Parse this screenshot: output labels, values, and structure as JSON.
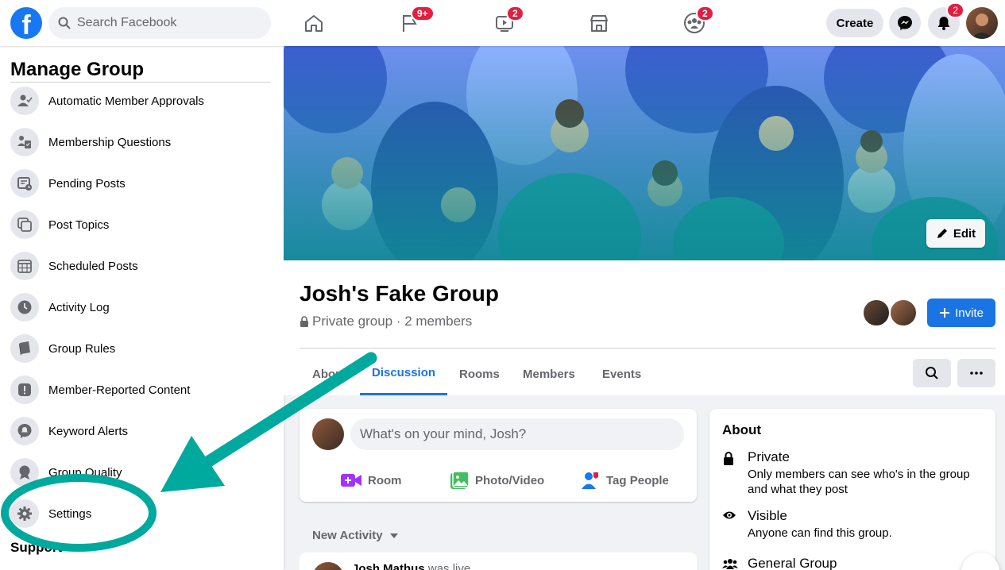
{
  "topbar": {
    "logo": "f",
    "search_placeholder": "Search Facebook",
    "nav": [
      {
        "name": "home-icon",
        "badge": ""
      },
      {
        "name": "pages-flag-icon",
        "badge": "9+"
      },
      {
        "name": "watch-icon",
        "badge": "2"
      },
      {
        "name": "marketplace-icon",
        "badge": ""
      },
      {
        "name": "groups-icon",
        "badge": "2"
      }
    ],
    "create_label": "Create",
    "notifications_badge": "2"
  },
  "sidebar": {
    "title": "Manage Group",
    "items": [
      {
        "label": "Automatic Member Approvals",
        "icon": "member-approval-icon"
      },
      {
        "label": "Membership Questions",
        "icon": "membership-questions-icon"
      },
      {
        "label": "Pending Posts",
        "icon": "pending-posts-icon"
      },
      {
        "label": "Post Topics",
        "icon": "post-topics-icon"
      },
      {
        "label": "Scheduled Posts",
        "icon": "calendar-icon"
      },
      {
        "label": "Activity Log",
        "icon": "clock-icon"
      },
      {
        "label": "Group Rules",
        "icon": "book-icon"
      },
      {
        "label": "Member-Reported Content",
        "icon": "alert-icon"
      },
      {
        "label": "Keyword Alerts",
        "icon": "keyword-alert-icon"
      },
      {
        "label": "Group Quality",
        "icon": "badge-icon"
      },
      {
        "label": "Settings",
        "icon": "gear-icon"
      }
    ],
    "support_heading": "Support"
  },
  "cover": {
    "edit_label": "Edit"
  },
  "group": {
    "name": "Josh's Fake Group",
    "meta": "Private group · 2 members",
    "invite_label": "Invite",
    "tabs": [
      "About",
      "Discussion",
      "Rooms",
      "Members",
      "Events"
    ],
    "active_tab": "Discussion"
  },
  "composer": {
    "placeholder": "What's on your mind, Josh?",
    "actions": [
      {
        "label": "Room",
        "color": "#a033ff"
      },
      {
        "label": "Photo/Video",
        "color": "#45bd62"
      },
      {
        "label": "Tag People",
        "color": "#1877f2"
      }
    ]
  },
  "feed": {
    "sort_label": "New Activity",
    "first_post_author": "Josh Mathus",
    "first_post_action": "was live."
  },
  "about": {
    "heading": "About",
    "rows": [
      {
        "title": "Private",
        "desc": "Only members can see who's in the group and what they post"
      },
      {
        "title": "Visible",
        "desc": "Anyone can find this group."
      },
      {
        "title": "General Group",
        "desc": ""
      }
    ]
  },
  "colors": {
    "brand": "#1877f2",
    "annotation": "#00a99d",
    "badge": "#e41e3f"
  }
}
